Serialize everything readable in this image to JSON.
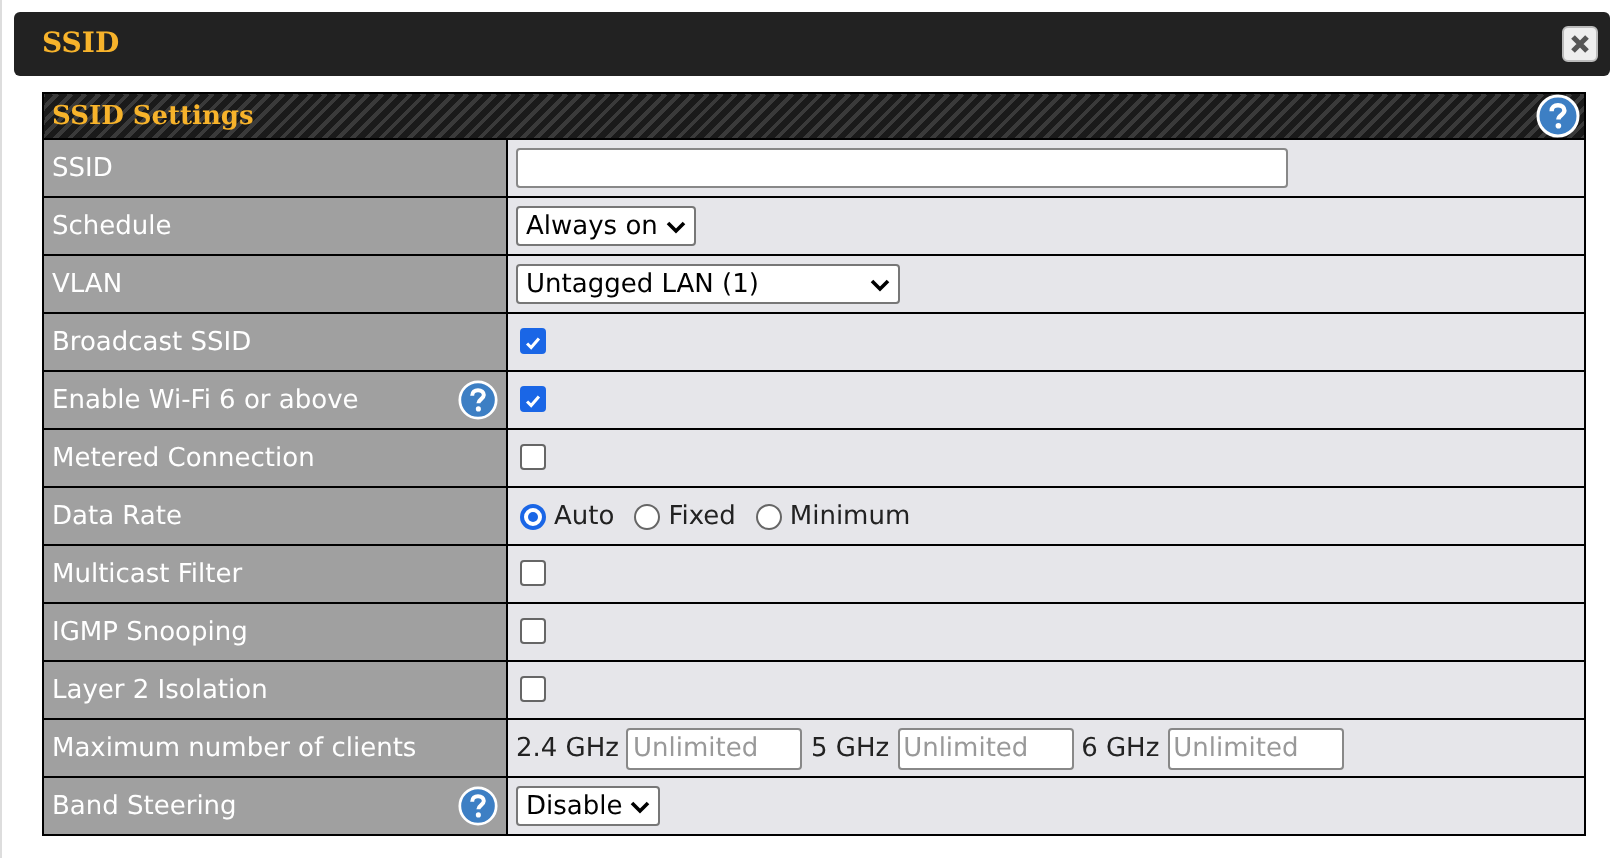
{
  "window": {
    "title": "SSID"
  },
  "section": {
    "title": "SSID Settings"
  },
  "rows": [
    {
      "label": "SSID",
      "kind": "text",
      "help": false,
      "value": ""
    },
    {
      "label": "Schedule",
      "kind": "select",
      "help": false,
      "value": "Always on"
    },
    {
      "label": "VLAN",
      "kind": "select",
      "help": false,
      "value": "Untagged LAN (1)",
      "wide": true
    },
    {
      "label": "Broadcast SSID",
      "kind": "checkbox",
      "help": false,
      "checked": true
    },
    {
      "label": "Enable Wi-Fi 6 or above",
      "kind": "checkbox",
      "help": true,
      "checked": true
    },
    {
      "label": "Metered Connection",
      "kind": "checkbox",
      "help": false,
      "checked": false
    },
    {
      "label": "Data Rate",
      "kind": "radio",
      "help": false,
      "options": [
        {
          "label": "Auto",
          "selected": true
        },
        {
          "label": "Fixed",
          "selected": false
        },
        {
          "label": "Minimum",
          "selected": false
        }
      ]
    },
    {
      "label": "Multicast Filter",
      "kind": "checkbox",
      "help": false,
      "checked": false
    },
    {
      "label": "IGMP Snooping",
      "kind": "checkbox",
      "help": false,
      "checked": false
    },
    {
      "label": "Layer 2 Isolation",
      "kind": "checkbox",
      "help": false,
      "checked": false
    },
    {
      "label": "Maximum number of clients",
      "kind": "clients",
      "help": false,
      "bands": [
        {
          "label": "2.4 GHz",
          "placeholder": "Unlimited"
        },
        {
          "label": "5 GHz",
          "placeholder": "Unlimited"
        },
        {
          "label": "6 GHz",
          "placeholder": "Unlimited"
        }
      ]
    },
    {
      "label": "Band Steering",
      "kind": "select",
      "help": true,
      "value": "Disable"
    }
  ]
}
